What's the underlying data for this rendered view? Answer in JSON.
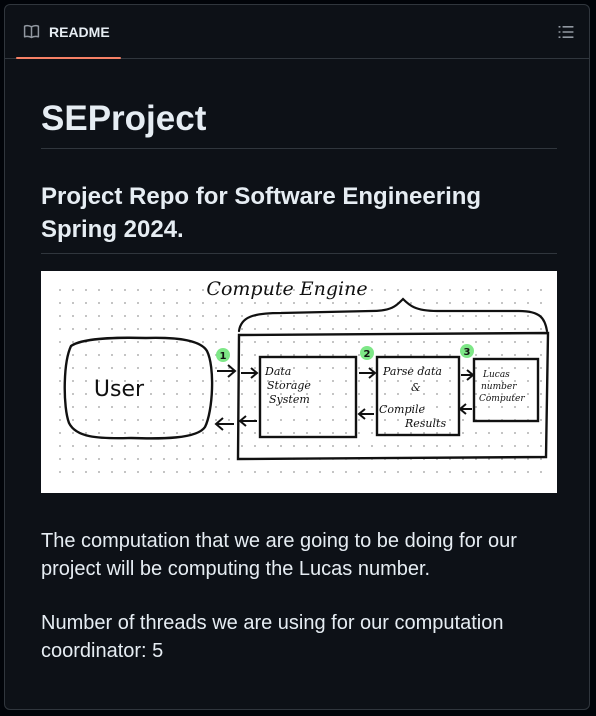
{
  "tab": {
    "label": "README",
    "icon": "book-icon"
  },
  "toolbar": {
    "outline_icon": "list-unordered-icon"
  },
  "readme": {
    "title": "SEProject",
    "subtitle": "Project Repo for Software Engineering Spring 2024.",
    "paragraphs": [
      "The computation that we are going to be doing for our project will be computing the Lucas number.",
      "Number of threads we are using for our computation coordinator: 5"
    ]
  },
  "diagram": {
    "header": "Compute Engine",
    "user_label": "User",
    "boxes": [
      {
        "step": "1",
        "text": [
          "Data",
          "Storage",
          "System"
        ]
      },
      {
        "step": "2",
        "text": [
          "Parse data",
          "&",
          "Compile",
          "Results"
        ]
      },
      {
        "step": "3",
        "text": [
          "Lucas",
          "number",
          "Computer"
        ]
      }
    ]
  },
  "colors": {
    "accent": "#f78166",
    "background": "#0d1117",
    "border": "#30363d",
    "text": "#e6edf3",
    "step_badge": "#7ee787"
  }
}
